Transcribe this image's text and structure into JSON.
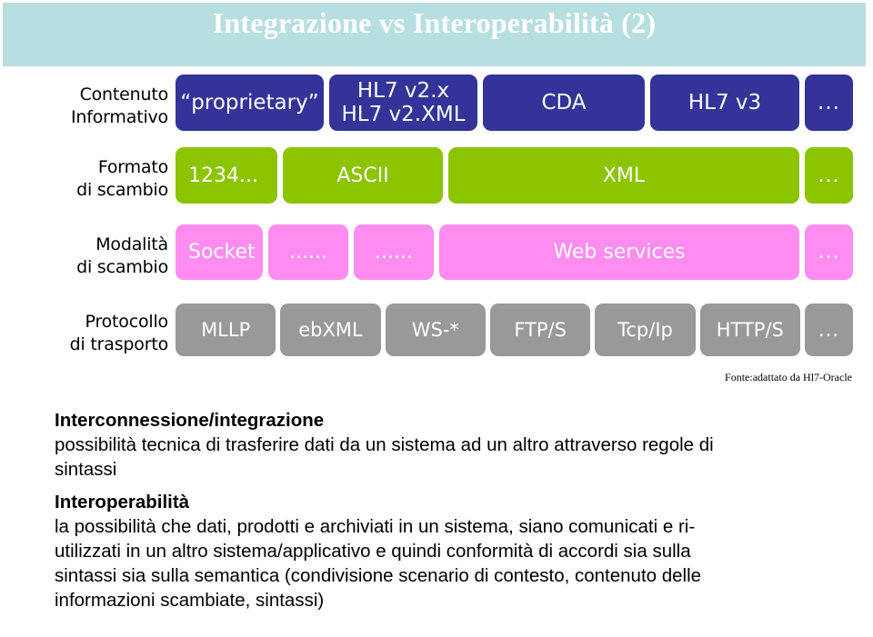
{
  "slide": {
    "title": "Integrazione vs Interoperabilità (2)",
    "title_bg": "#b8dfdf",
    "title_color": "#ffffff"
  },
  "colors": {
    "layer_contenuto": "#333399",
    "layer_formato": "#8cc400",
    "layer_modalita": "#ff8cf0",
    "layer_protocollo": "#999999"
  },
  "diagram": {
    "rows": [
      {
        "label_line1": "Contenuto",
        "label_line2": "Informativo",
        "cells": [
          {
            "text": "“proprietary”",
            "flex": "0 0 163px"
          },
          {
            "text": "HL7 v2.x\nHL7 v2.XML",
            "flex": "0 0 163px"
          },
          {
            "text": "CDA",
            "flex": "0 0 178px"
          },
          {
            "text": "HL7 v3",
            "flex": "0 0 164px"
          },
          {
            "text": "...",
            "flex": "0 0 53px"
          }
        ]
      },
      {
        "label_line1": "Formato",
        "label_line2": "di scambio",
        "cells": [
          {
            "text": "1234...",
            "flex": "0 0 112px"
          },
          {
            "text": "ASCII",
            "flex": "0 0 176px"
          },
          {
            "text": "XML",
            "flex": "1 1 auto"
          },
          {
            "text": "...",
            "flex": "0 0 53px"
          }
        ]
      },
      {
        "label_line1": "Modalità",
        "label_line2": "di scambio",
        "cells": [
          {
            "text": "Socket",
            "flex": "0 0 96px"
          },
          {
            "text": "......",
            "flex": "0 0 88px"
          },
          {
            "text": "......",
            "flex": "0 0 88px"
          },
          {
            "text": "Web services",
            "flex": "1 1 auto"
          },
          {
            "text": "...",
            "flex": "0 0 53px"
          }
        ]
      },
      {
        "label_line1": "Protocollo",
        "label_line2": "di trasporto",
        "cells": [
          {
            "text": "MLLP",
            "flex": "1 1 0"
          },
          {
            "text": "ebXML",
            "flex": "1 1 0"
          },
          {
            "text": "WS-*",
            "flex": "1 1 0"
          },
          {
            "text": "FTP/S",
            "flex": "1 1 0"
          },
          {
            "text": "Tcp/Ip",
            "flex": "1 1 0"
          },
          {
            "text": "HTTP/S",
            "flex": "1 1 0"
          },
          {
            "text": "...",
            "flex": "0 0 53px"
          }
        ]
      }
    ],
    "source_note": "Fonte:adattato da Hl7-Oracle"
  },
  "body": {
    "block1_heading": "Interconnessione/integrazione",
    "block1_line1": "possibilità tecnica di trasferire dati da un sistema ad un altro attraverso regole di",
    "block1_line2": "sintassi",
    "block2_heading": "Interoperabilità",
    "block2_line1": "la possibilità che dati, prodotti e archiviati in un sistema, siano comunicati e ri-",
    "block2_line2": "utilizzati in un altro sistema/applicativo e quindi conformità di accordi sia sulla",
    "block2_line3": "sintassi sia sulla semantica (condivisione scenario di contesto, contenuto delle",
    "block2_line4": "informazioni scambiate, sintassi)"
  }
}
